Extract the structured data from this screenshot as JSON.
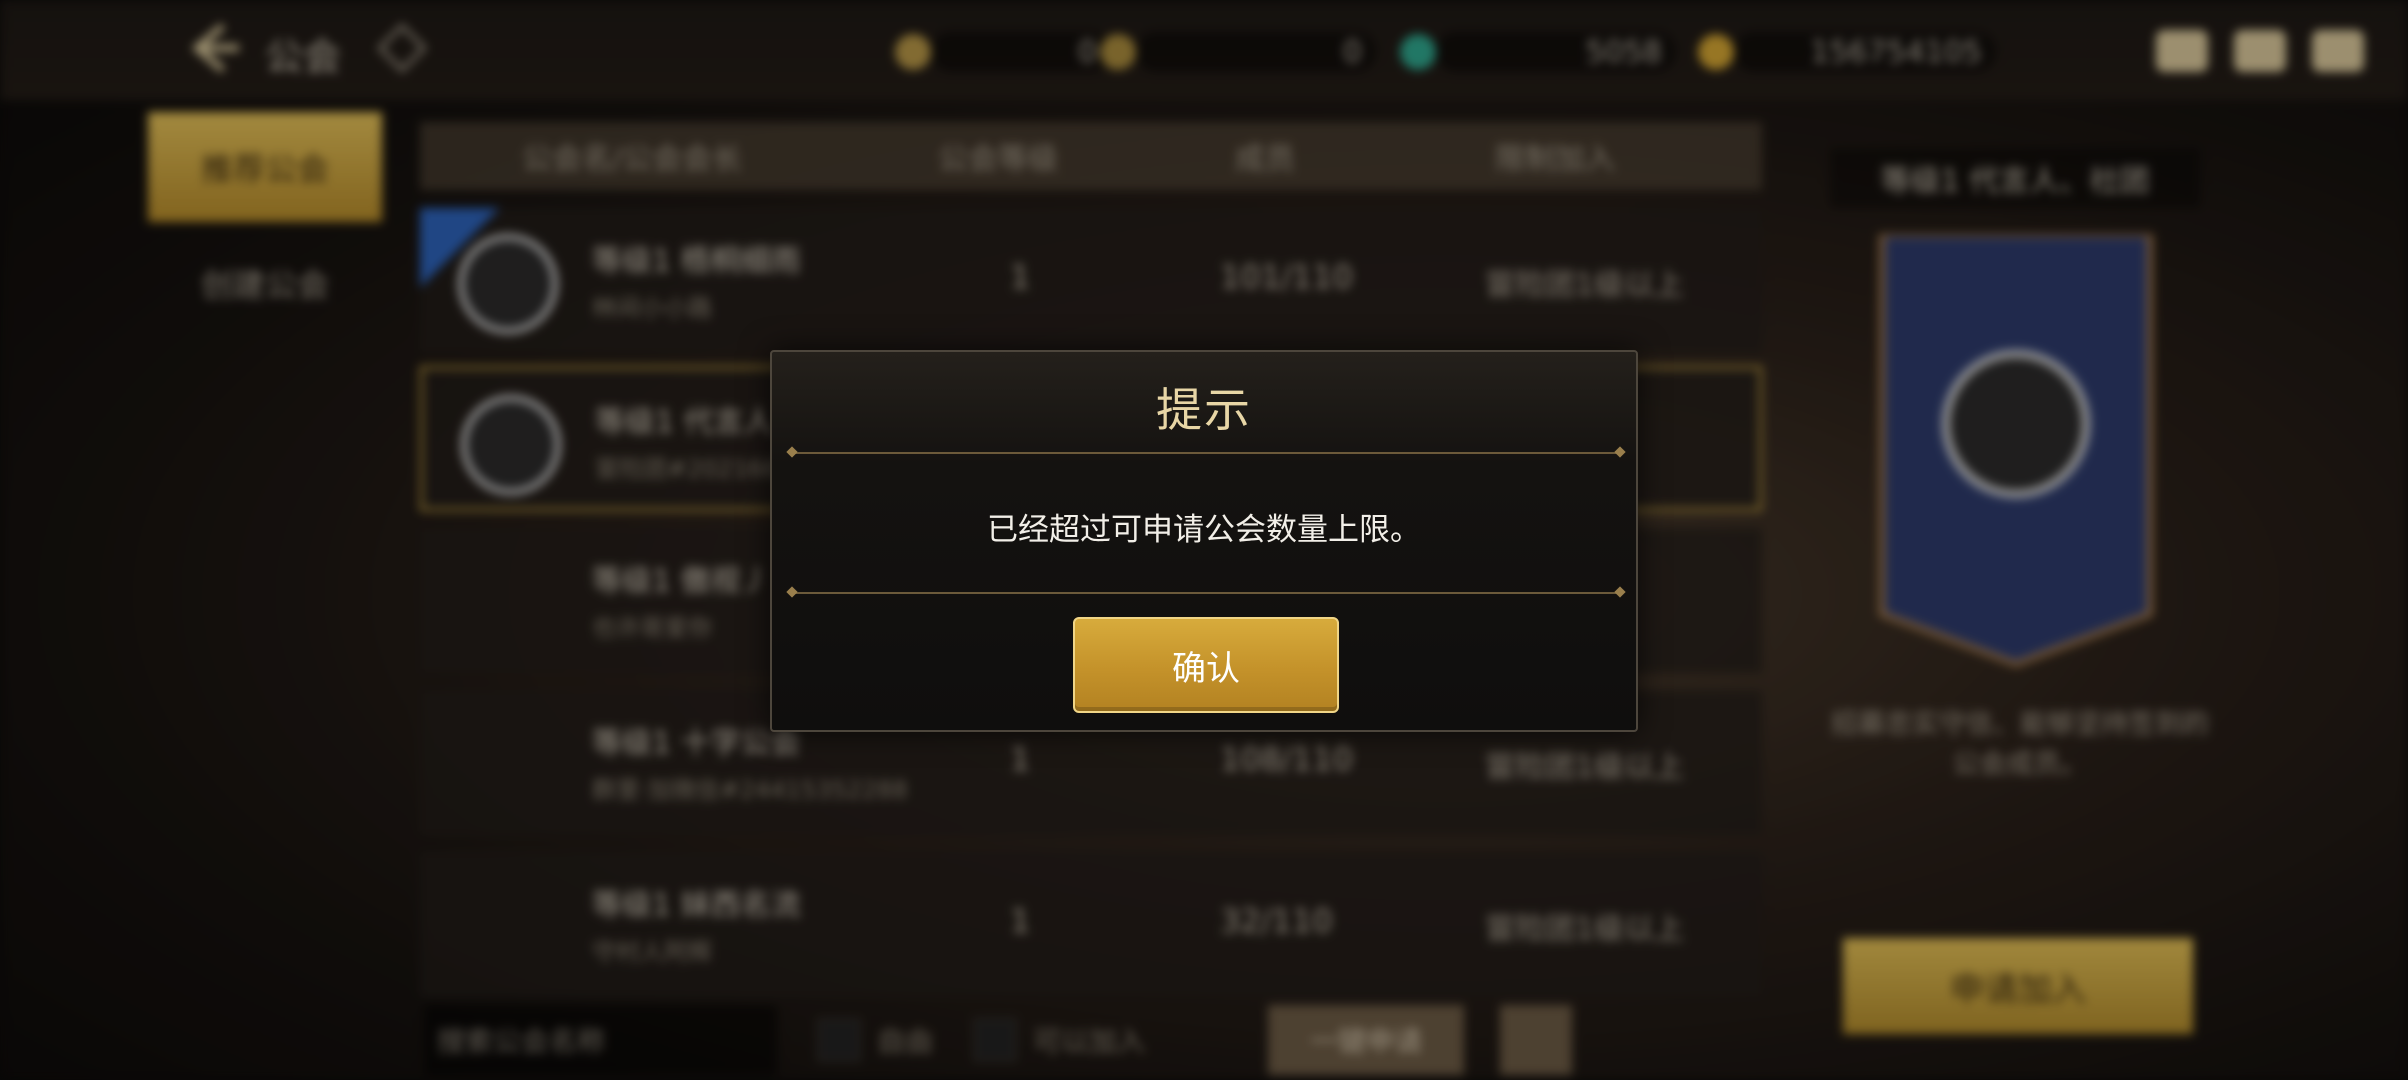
{
  "topbar": {
    "title": "公会",
    "currencies": [
      "0",
      "0",
      "5058",
      "156754105"
    ]
  },
  "sidebar": {
    "items": [
      {
        "label": "推荐公会"
      },
      {
        "label": "创建公会"
      }
    ]
  },
  "table": {
    "headers": [
      "公会名/公会会长",
      "公会等级",
      "成员",
      "限制加入"
    ],
    "rows": [
      {
        "name": "等级1 梧桐细雨",
        "leader": "林间小小路",
        "level": "1",
        "members": "101/110",
        "limit": "冒险团1级以上"
      },
      {
        "name": "等级1 代言人",
        "leader": "冒险团#2021661",
        "level": "",
        "members": "",
        "limit": "以上"
      },
      {
        "name": "等级1 傲视丿",
        "leader": "也许哥爱你",
        "level": "",
        "members": "",
        "limit": "以上"
      },
      {
        "name": "等级1 十字公会",
        "leader": "群里·加微信#24415352288",
        "level": "1",
        "members": "108/110",
        "limit": "冒险团1级以上"
      },
      {
        "name": "等级1 妹西名流",
        "leader": "守村人阿辉",
        "level": "1",
        "members": "32/110",
        "limit": "冒险团1级以上"
      }
    ]
  },
  "bottom": {
    "search_placeholder": "搜索公会名称",
    "filter_free": "自由",
    "filter_joinable": "可以加入",
    "quick_apply": "一键申请"
  },
  "right_panel": {
    "title": "等级1 代言人、社团",
    "description": "招募忠实守信、能够坚持签到的公会成员。",
    "apply_label": "申请加入"
  },
  "modal": {
    "title": "提示",
    "message": "已经超过可申请公会数量上限。",
    "confirm_label": "确认"
  },
  "colors": {
    "accent_gold": "#c4922a",
    "modal_title": "#e8d6a6"
  }
}
